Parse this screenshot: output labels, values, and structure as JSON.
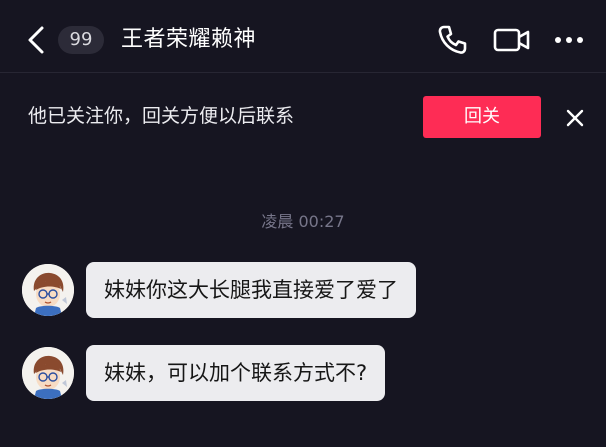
{
  "header": {
    "back_icon": "chevron-left-icon",
    "unread_count": "99",
    "title": "王者荣耀赖神",
    "icons": [
      "phone-icon",
      "video-camera-icon",
      "more-dots-icon"
    ]
  },
  "follow_bar": {
    "text": "他已关注你，回关方便以后联系",
    "button_label": "回关",
    "button_color": "#fe2c55",
    "close_icon": "close-icon"
  },
  "chat": {
    "timestamp": "凌晨 00:27",
    "messages": [
      {
        "text": "妹妹你这大长腿我直接爱了爱了",
        "avatar": "cartoon-avatar"
      },
      {
        "text": "妹妹，可以加个联系方式不?",
        "avatar": "cartoon-avatar"
      }
    ]
  },
  "colors": {
    "background": "#161521",
    "bubble": "#ececef",
    "accent": "#fe2c55",
    "timestamp": "#77768a"
  }
}
